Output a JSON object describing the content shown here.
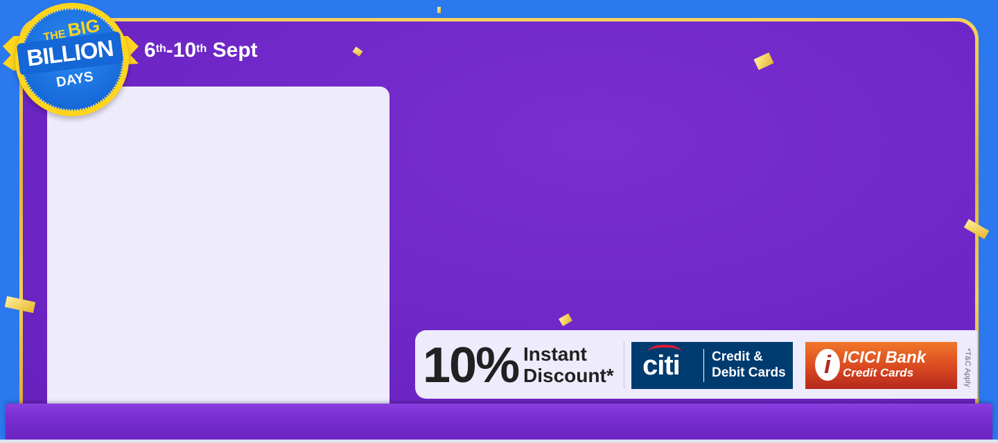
{
  "badge": {
    "line1": "THE",
    "line2": "BIG",
    "line3": "BILLION",
    "line4": "DAYS"
  },
  "sale": {
    "dates": {
      "start": "6",
      "start_suffix": "th",
      "separator": "-",
      "end": "10",
      "end_suffix": "th",
      "month": "Sept"
    }
  },
  "offer": {
    "discount": "10%",
    "line1": "Instant",
    "line2": "Discount*",
    "banks": [
      {
        "logo_text": "citi",
        "line1": "Credit &",
        "line2": "Debit Cards"
      },
      {
        "logo_letter": "i",
        "name": "ICICI Bank",
        "line2": "Credit Cards"
      }
    ],
    "terms": "*T&C Apply"
  },
  "colors": {
    "background": "#2c78ee",
    "board": "#7028c8",
    "frame_gold": "#e2b53c",
    "panel": "#eeebfd",
    "citi_blue": "#003b70",
    "icici_orange": "#d9481f",
    "badge_yellow": "#ffd51e",
    "badge_blue": "#1566d6"
  }
}
